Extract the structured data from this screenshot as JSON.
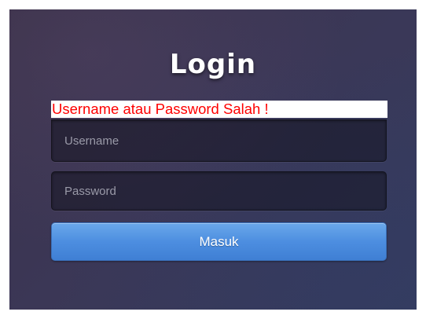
{
  "login": {
    "title": "Login",
    "error_message": "Username atau Password Salah !",
    "username_placeholder": "Username",
    "password_placeholder": "Password",
    "submit_label": "Masuk"
  },
  "colors": {
    "error_text": "#ff0000",
    "button_blue": "#4d8ee0",
    "background": "#3b3756"
  }
}
